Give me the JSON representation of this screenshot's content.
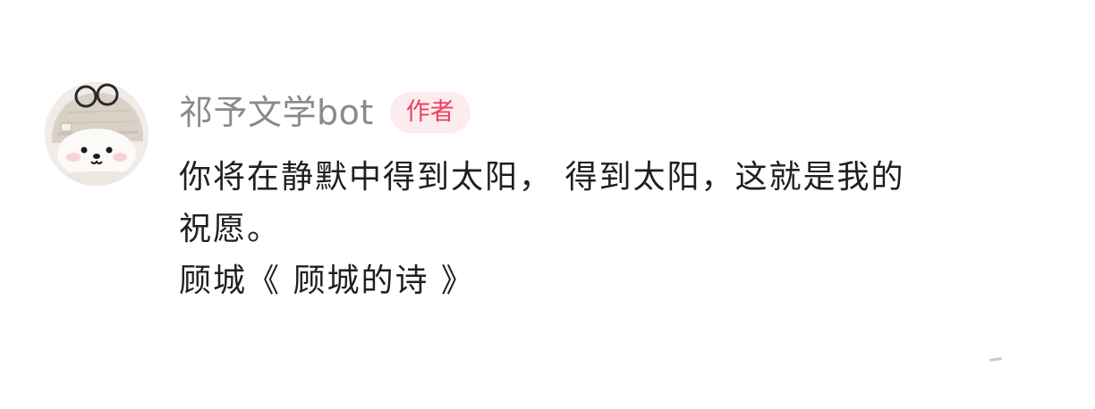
{
  "comment": {
    "author": {
      "name": "祁予文学bot",
      "badge": "作者",
      "avatar_icon": "bear-avatar-with-glasses"
    },
    "lines": [
      "你将在静默中得到太阳，  得到太阳，这就是我的",
      "祝愿。",
      "顾城《 顾城的诗 》"
    ]
  },
  "colors": {
    "author_name": "#8a8a8a",
    "badge_bg": "#fdecef",
    "badge_text": "#e8425e",
    "body_text": "#1f1f1f"
  }
}
